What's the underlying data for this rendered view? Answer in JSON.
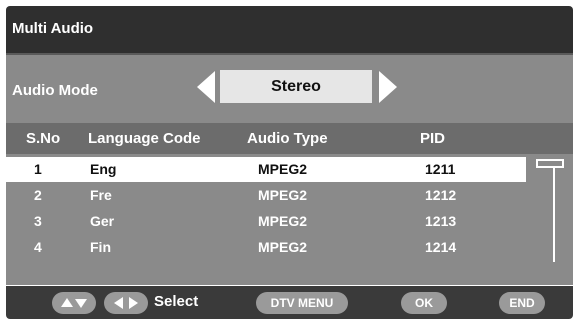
{
  "window": {
    "title": "Multi Audio"
  },
  "audio_mode": {
    "label": "Audio Mode",
    "value": "Stereo"
  },
  "table": {
    "headers": [
      "S.No",
      "Language Code",
      "Audio Type",
      "PID"
    ],
    "rows": [
      {
        "sno": "1",
        "lang": "Eng",
        "type": "MPEG2",
        "pid": "1211"
      },
      {
        "sno": "2",
        "lang": "Fre",
        "type": "MPEG2",
        "pid": "1212"
      },
      {
        "sno": "3",
        "lang": "Ger",
        "type": "MPEG2",
        "pid": "1213"
      },
      {
        "sno": "4",
        "lang": "Fin",
        "type": "MPEG2",
        "pid": "1214"
      }
    ],
    "selected_index": 0
  },
  "footer": {
    "select_label": "Select",
    "dtv_menu_label": "DTV MENU",
    "ok_label": "OK",
    "end_label": "END"
  },
  "icons": [
    "up-down-arrows-icon",
    "left-right-arrows-icon",
    "mode-left-arrow-icon",
    "mode-right-arrow-icon"
  ]
}
